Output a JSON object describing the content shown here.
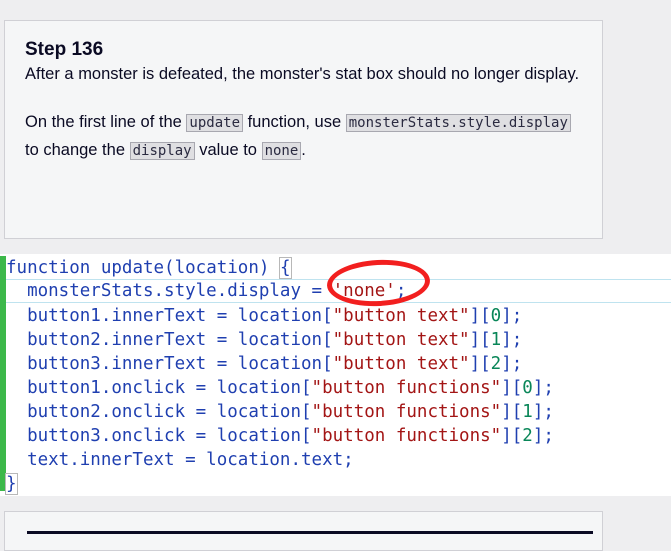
{
  "step": {
    "title": "Step 136",
    "paragraph1": "After a monster is defeated, the monster's stat box should no longer display.",
    "p2_before": "On the first line of the ",
    "p2_code1": "update",
    "p2_mid1": " function, use ",
    "p2_code2": "monsterStats.style.display",
    "p2_mid2": " to change the ",
    "p2_code3": "display",
    "p2_mid3": " value to ",
    "p2_code4": "none",
    "p2_end": "."
  },
  "code": {
    "line1": {
      "kw": "function",
      "name": " update(location) ",
      "brace": "{"
    },
    "line2": {
      "lhs": "  monsterStats.style.display = ",
      "str": "'none'",
      "end": ";"
    },
    "line3": {
      "lhs": "  button1.innerText = location[",
      "str": "\"button text\"",
      "idx_open": "][",
      "num": "0",
      "end": "];"
    },
    "line4": {
      "lhs": "  button2.innerText = location[",
      "str": "\"button text\"",
      "idx_open": "][",
      "num": "1",
      "end": "];"
    },
    "line5": {
      "lhs": "  button3.innerText = location[",
      "str": "\"button text\"",
      "idx_open": "][",
      "num": "2",
      "end": "];"
    },
    "line6": {
      "lhs": "  button1.onclick = location[",
      "str": "\"button functions\"",
      "idx_open": "][",
      "num": "0",
      "end": "];"
    },
    "line7": {
      "lhs": "  button2.onclick = location[",
      "str": "\"button functions\"",
      "idx_open": "][",
      "num": "1",
      "end": "];"
    },
    "line8": {
      "lhs": "  button3.onclick = location[",
      "str": "\"button functions\"",
      "idx_open": "][",
      "num": "2",
      "end": "];"
    },
    "line9": {
      "text": "  text.innerText = location.text;"
    },
    "line10": {
      "brace": "}"
    }
  },
  "colors": {
    "keyword": "#1f3fb0",
    "string": "#a31515",
    "number": "#098658",
    "gutter": "#3cb84a",
    "annotation": "#f21f1f"
  }
}
